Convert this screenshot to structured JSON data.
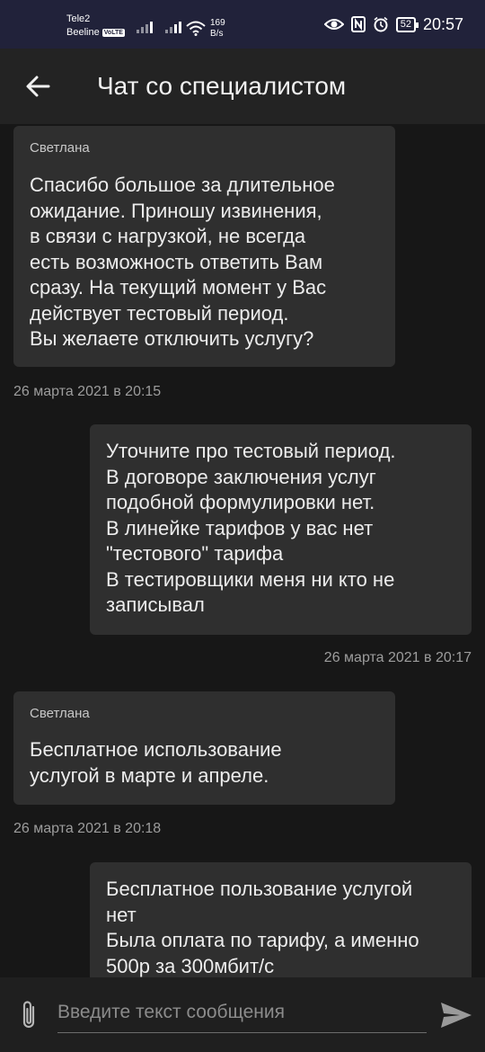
{
  "status_bar": {
    "carrier_1": "Tele2",
    "carrier_2": "Beeline",
    "volte": "VoLTE",
    "net_speed": "169",
    "net_unit": "B/s",
    "battery": "52",
    "time": "20:57"
  },
  "header": {
    "title": "Чат со специалистом"
  },
  "messages": [
    {
      "sender": "Светлана",
      "text": "Спасибо большое за длительное\nожидание. Приношу извинения,\nв связи с нагрузкой, не всегда\nесть возможность ответить Вам\nсразу.  На текущий момент у Вас\nдействует тестовый период.\nВы желаете отключить услугу?",
      "time": "26 марта 2021 в 20:15"
    },
    {
      "sender": "",
      "text": "Уточните про тестовый период.\nВ договоре заключения услуг\nподобной формулировки нет.\nВ линейке тарифов у вас нет\n\"тестового\" тарифа\nВ тестировщики  меня ни кто не\nзаписывал",
      "time": "26 марта 2021 в 20:17"
    },
    {
      "sender": "Светлана",
      "text": "Бесплатное использование\nуслугой в марте и апреле.",
      "time": "26 марта 2021 в 20:18"
    },
    {
      "sender": "",
      "text": "Бесплатное пользование услугой\nнет\nБыла оплата по тарифу, а именно\n500р за 300мбит/с",
      "time": ""
    }
  ],
  "composer": {
    "placeholder": "Введите текст сообщения"
  },
  "icons": {
    "back": "arrow-left-icon",
    "attach": "paperclip-icon",
    "send": "send-icon"
  },
  "colors": {
    "background": "#171717",
    "bubble": "#2f2f2f",
    "header": "#232323",
    "status_bar": "#21223a"
  }
}
